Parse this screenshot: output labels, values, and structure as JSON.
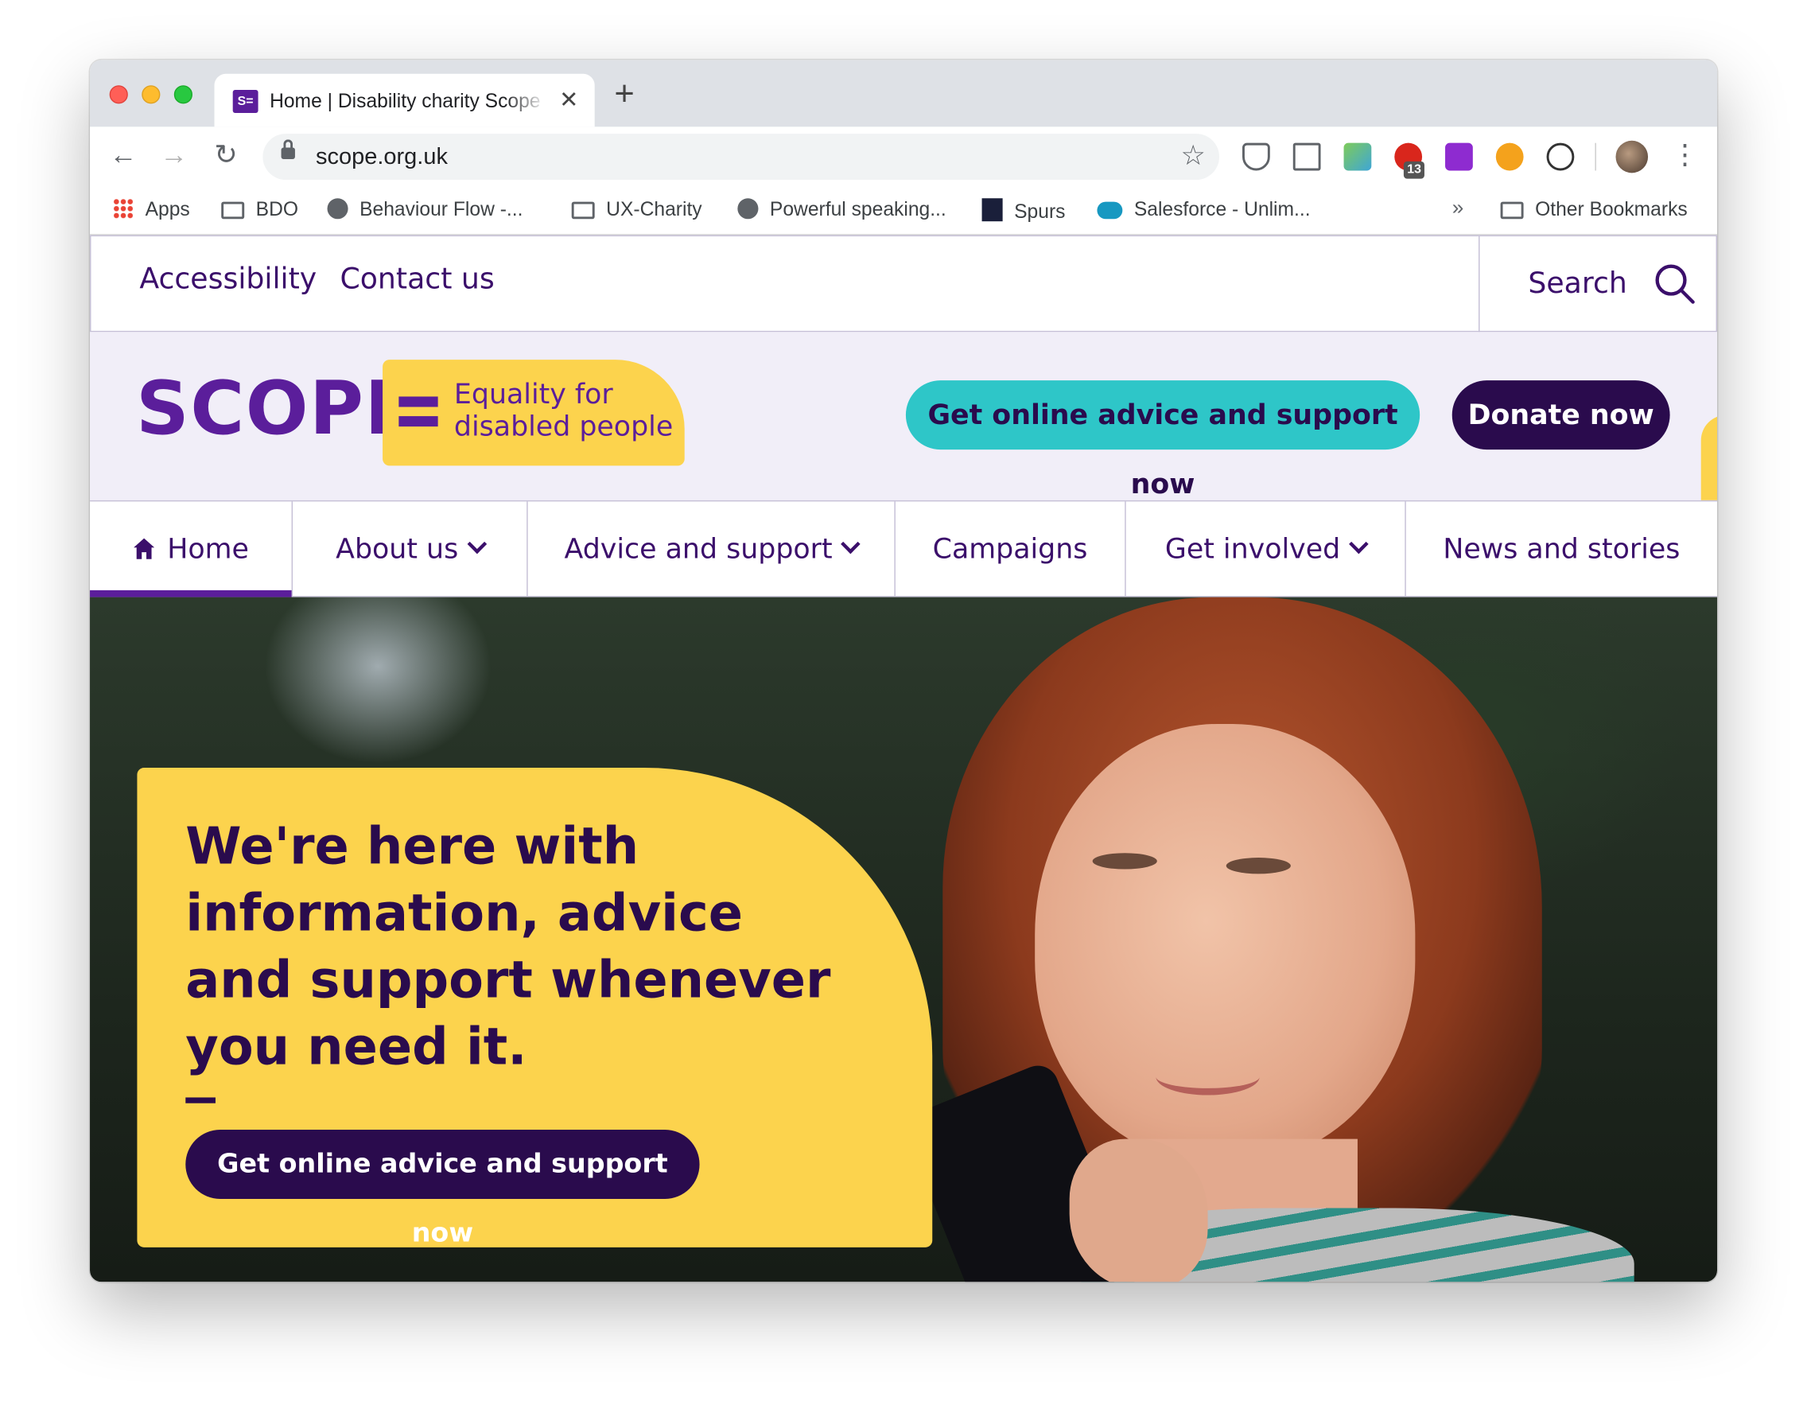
{
  "browser": {
    "tab_title": "Home | Disability charity Scope",
    "tab_favicon_text": "S=",
    "url": "scope.org.uk",
    "extension_badge": "13",
    "bookmarks": [
      {
        "label": "Apps",
        "icon": "apps-grid-icon"
      },
      {
        "label": "BDO",
        "icon": "folder-icon"
      },
      {
        "label": "Behaviour Flow -...",
        "icon": "globe-icon"
      },
      {
        "label": "UX-Charity",
        "icon": "folder-icon"
      },
      {
        "label": "Powerful speaking...",
        "icon": "globe-icon"
      },
      {
        "label": "Spurs",
        "icon": "spurs-icon"
      },
      {
        "label": "Salesforce - Unlim...",
        "icon": "salesforce-icon"
      }
    ],
    "bookmarks_overflow": "»",
    "other_bookmarks": "Other Bookmarks"
  },
  "utility_nav": {
    "accessibility": "Accessibility",
    "contact": "Contact us",
    "search": "Search"
  },
  "brand": {
    "logo_word": "SCOPE",
    "tagline_line1": "Equality for",
    "tagline_line2": "disabled people",
    "cta_advice": "Get online advice and support now",
    "cta_donate": "Donate now",
    "colors": {
      "purple": "#5b1e9b",
      "dark_purple": "#2a0b4d",
      "yellow": "#fcd34d",
      "teal": "#2ec6c8"
    }
  },
  "main_nav": [
    {
      "label": "Home",
      "active": true
    },
    {
      "label": "About us",
      "dropdown": true
    },
    {
      "label": "Advice and support",
      "dropdown": true
    },
    {
      "label": "Campaigns"
    },
    {
      "label": "Get involved",
      "dropdown": true
    },
    {
      "label": "News and stories"
    }
  ],
  "hero": {
    "title": "We're here with information, advice and support whenever you need it.",
    "button": "Get online advice and support now"
  }
}
